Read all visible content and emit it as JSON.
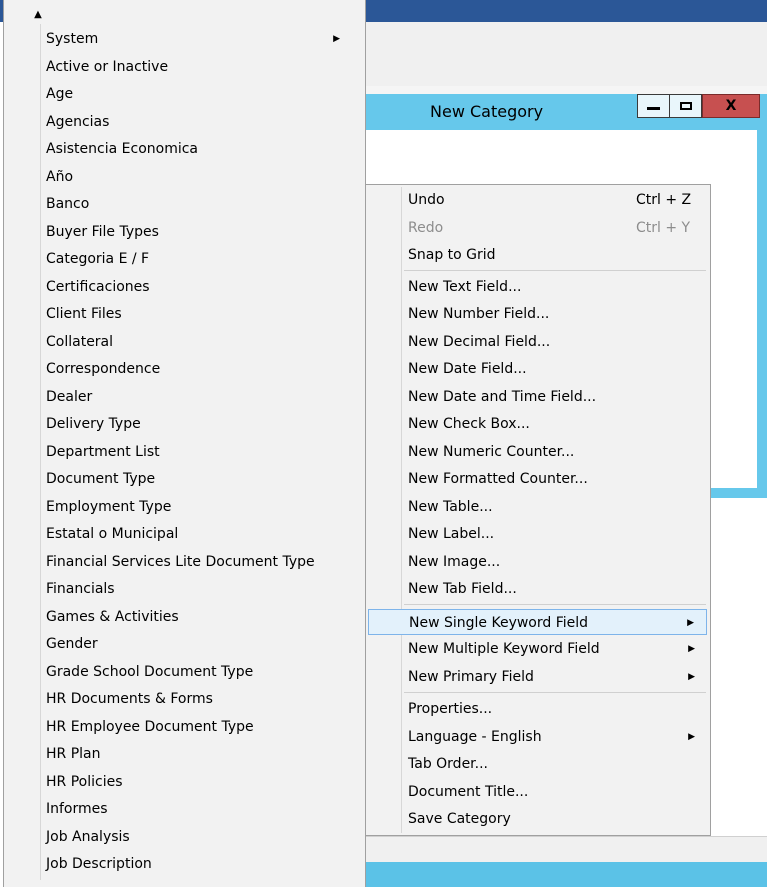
{
  "dialog": {
    "title": "New Category",
    "close_label": "X"
  },
  "left_menu": {
    "scroll_up_glyph": "▲",
    "items": [
      {
        "label": "System",
        "has_submenu": true
      },
      {
        "label": "Active or Inactive"
      },
      {
        "label": "Age"
      },
      {
        "label": "Agencias"
      },
      {
        "label": "Asistencia Economica"
      },
      {
        "label": "Año"
      },
      {
        "label": "Banco"
      },
      {
        "label": "Buyer File Types"
      },
      {
        "label": "Categoria E / F"
      },
      {
        "label": "Certificaciones"
      },
      {
        "label": "Client Files"
      },
      {
        "label": "Collateral"
      },
      {
        "label": "Correspondence"
      },
      {
        "label": "Dealer"
      },
      {
        "label": "Delivery Type"
      },
      {
        "label": "Department List"
      },
      {
        "label": "Document Type"
      },
      {
        "label": "Employment Type"
      },
      {
        "label": "Estatal o Municipal"
      },
      {
        "label": "Financial Services Lite Document Type"
      },
      {
        "label": "Financials"
      },
      {
        "label": "Games & Activities"
      },
      {
        "label": "Gender"
      },
      {
        "label": "Grade School Document Type"
      },
      {
        "label": "HR Documents & Forms"
      },
      {
        "label": "HR Employee Document Type"
      },
      {
        "label": "HR Plan"
      },
      {
        "label": "HR Policies"
      },
      {
        "label": "Informes"
      },
      {
        "label": "Job Analysis"
      },
      {
        "label": "Job Description"
      }
    ]
  },
  "context_menu": {
    "items": [
      {
        "label": "Undo",
        "shortcut": "Ctrl + Z"
      },
      {
        "label": "Redo",
        "shortcut": "Ctrl + Y",
        "disabled": true
      },
      {
        "label": "Snap to Grid"
      },
      {
        "label": "New Text Field..."
      },
      {
        "label": "New Number Field..."
      },
      {
        "label": "New Decimal Field..."
      },
      {
        "label": "New Date Field..."
      },
      {
        "label": "New Date and Time Field..."
      },
      {
        "label": "New Check Box..."
      },
      {
        "label": "New Numeric Counter..."
      },
      {
        "label": "New Formatted Counter..."
      },
      {
        "label": "New Table..."
      },
      {
        "label": "New Label..."
      },
      {
        "label": "New Image..."
      },
      {
        "label": "New Tab Field..."
      },
      {
        "label": "New Single Keyword Field",
        "has_submenu": true,
        "highlighted": true
      },
      {
        "label": "New Multiple Keyword Field",
        "has_submenu": true
      },
      {
        "label": "New Primary Field",
        "has_submenu": true
      },
      {
        "label": "Properties..."
      },
      {
        "label": "Language - English",
        "has_submenu": true
      },
      {
        "label": "Tab Order..."
      },
      {
        "label": "Document Title..."
      },
      {
        "label": "Save Category"
      }
    ]
  },
  "colors": {
    "dialog_frame": "#66c8eb",
    "close_button": "#c75050",
    "highlight": "#e3f1fb",
    "highlight_border": "#7eb4ea"
  }
}
